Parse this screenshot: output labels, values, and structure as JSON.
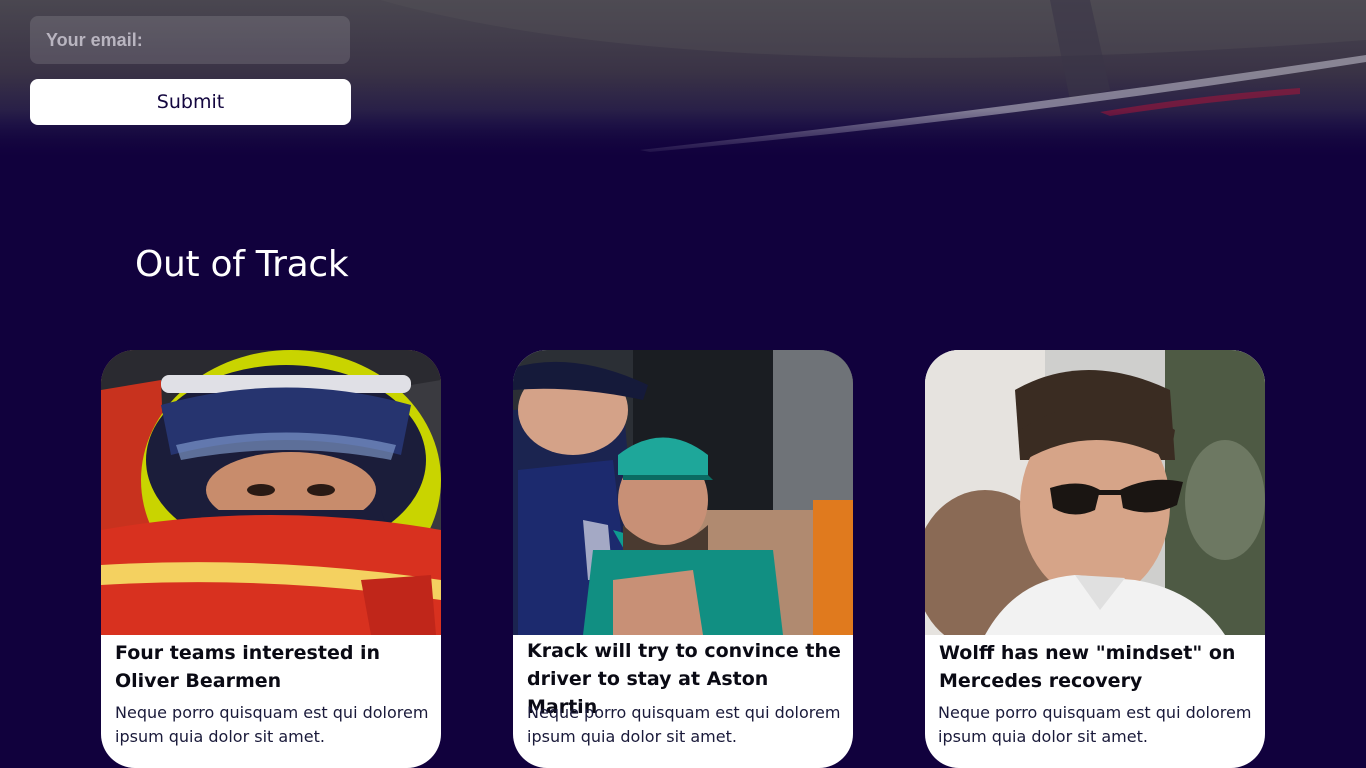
{
  "newsletter": {
    "email_placeholder": "Your email:",
    "submit_label": "Submit"
  },
  "section": {
    "title": "Out of Track"
  },
  "cards": [
    {
      "title": "Four teams interested in Oliver Bearmen",
      "text": "Neque porro quisquam est qui dolorem ipsum quia dolor sit amet.",
      "image": "driver-helmet-photo"
    },
    {
      "title": "Krack will try to convince the driver to stay at Aston Martin",
      "text": "Neque porro quisquam est qui dolorem ipsum quia dolor sit amet.",
      "image": "drivers-paddock-photo"
    },
    {
      "title": "Wolff has new \"mindset\" on Mercedes recovery",
      "text": "Neque porro quisquam est qui dolorem ipsum quia dolor sit amet.",
      "image": "team-principal-sunglasses-photo"
    }
  ],
  "colors": {
    "background": "#11013d",
    "card_bg": "#ffffff",
    "button_text": "#13063f"
  }
}
